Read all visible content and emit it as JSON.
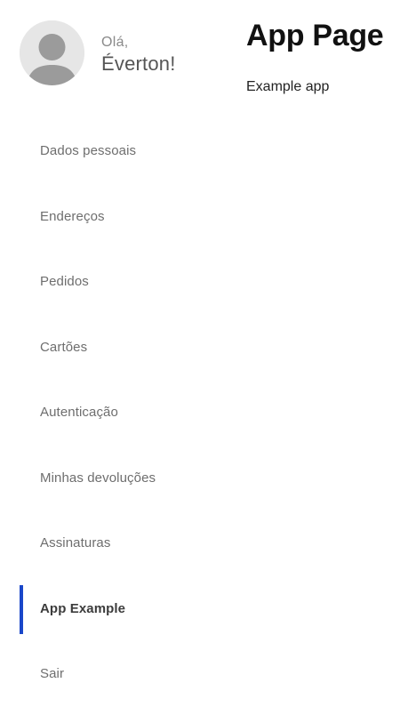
{
  "profile": {
    "greeting": "Olá,",
    "name": "Éverton!",
    "avatar_icon": "user-silhouette-icon"
  },
  "sidebar": {
    "items": [
      {
        "label": "Dados pessoais",
        "active": false
      },
      {
        "label": "Endereços",
        "active": false
      },
      {
        "label": "Pedidos",
        "active": false
      },
      {
        "label": "Cartões",
        "active": false
      },
      {
        "label": "Autenticação",
        "active": false
      },
      {
        "label": "Minhas devoluções",
        "active": false
      },
      {
        "label": "Assinaturas",
        "active": false
      },
      {
        "label": "App Example",
        "active": true
      },
      {
        "label": "Sair",
        "active": false
      }
    ],
    "active_indicator_color": "#1a47c9"
  },
  "main": {
    "title": "App Page",
    "subtitle": "Example app"
  }
}
